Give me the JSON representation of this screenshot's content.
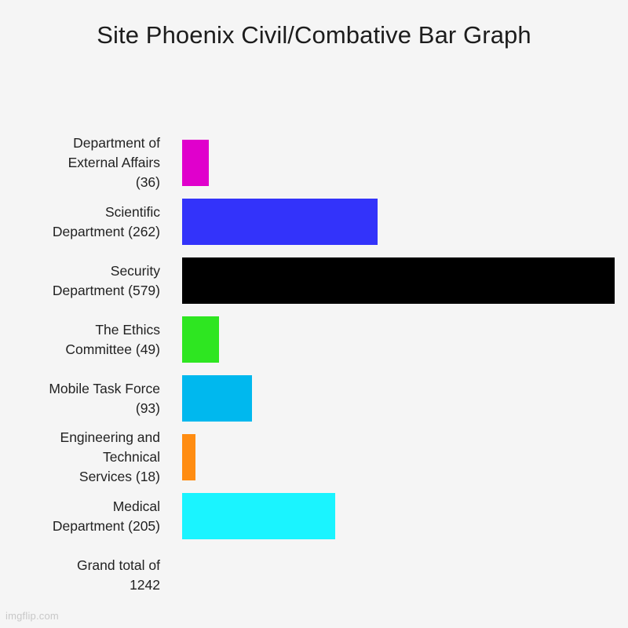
{
  "chart_data": {
    "type": "bar",
    "orientation": "horizontal",
    "title": "Site Phoenix Civil/Combative Bar Graph",
    "xlabel": "",
    "ylabel": "",
    "grid": false,
    "legend": false,
    "axis_visible": false,
    "xlim": [
      0,
      579
    ],
    "background_color": "#f5f5f5",
    "label_color": "#222222",
    "categories": [
      "Department of External Affairs",
      "Scientific Department",
      "Security Department",
      "The Ethics Committee",
      "Mobile Task Force",
      "Engineering and Technical Services",
      "Medical Department",
      "Grand total"
    ],
    "values": [
      36,
      262,
      579,
      49,
      93,
      18,
      205,
      1242
    ],
    "colors": [
      "#e000cc",
      "#3333fa",
      "#000000",
      "#2ee621",
      "#00b8ee",
      "#ff8c11",
      "#1af4ff",
      "none"
    ],
    "bars": [
      {
        "label": "Department of\nExternal Affairs\n(36)",
        "category": "Department of External Affairs",
        "value": 36,
        "color": "#e000cc",
        "has_bar": true
      },
      {
        "label": "Scientific\nDepartment (262)",
        "category": "Scientific Department",
        "value": 262,
        "color": "#3333fa",
        "has_bar": true
      },
      {
        "label": "Security\nDepartment (579)",
        "category": "Security Department",
        "value": 579,
        "color": "#000000",
        "has_bar": true
      },
      {
        "label": "The Ethics\nCommittee (49)",
        "category": "The Ethics Committee",
        "value": 49,
        "color": "#2ee621",
        "has_bar": true
      },
      {
        "label": "Mobile Task Force\n(93)",
        "category": "Mobile Task Force",
        "value": 93,
        "color": "#00b8ee",
        "has_bar": true
      },
      {
        "label": "Engineering and\nTechnical\nServices (18)",
        "category": "Engineering and Technical Services",
        "value": 18,
        "color": "#ff8c11",
        "has_bar": true
      },
      {
        "label": "Medical\nDepartment (205)",
        "category": "Medical Department",
        "value": 205,
        "color": "#1af4ff",
        "has_bar": true
      },
      {
        "label": "Grand total of\n1242",
        "category": "Grand total",
        "value": 1242,
        "color": "none",
        "has_bar": false
      }
    ]
  },
  "watermark": {
    "text": "imgflip.com"
  }
}
